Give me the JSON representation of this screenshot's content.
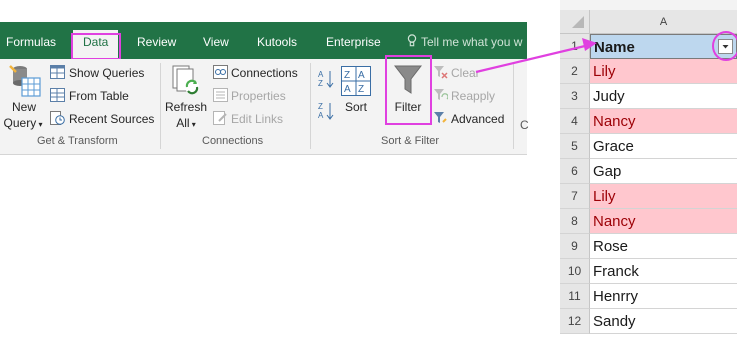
{
  "ribbon": {
    "tabs": [
      "Formulas",
      "Data",
      "Review",
      "View",
      "Kutools",
      "Enterprise"
    ],
    "tell_me": "Tell me what you w",
    "get_transform": {
      "new_query_line1": "New",
      "new_query_line2": "Query",
      "show_queries": "Show Queries",
      "from_table": "From Table",
      "recent_sources": "Recent Sources",
      "group_label": "Get & Transform"
    },
    "connections": {
      "refresh_line1": "Refresh",
      "refresh_line2": "All",
      "connections": "Connections",
      "properties": "Properties",
      "edit_links": "Edit Links",
      "group_label": "Connections"
    },
    "sort_filter": {
      "sort": "Sort",
      "filter": "Filter",
      "clear": "Clear",
      "reapply": "Reapply",
      "advanced": "Advanced",
      "group_label": "Sort & Filter"
    },
    "truncated_next": "C"
  },
  "sheet": {
    "column_header": "A",
    "header_row": {
      "row": "1",
      "value": "Name"
    },
    "rows": [
      {
        "row": "2",
        "value": "Lily",
        "duplicate": true
      },
      {
        "row": "3",
        "value": "Judy",
        "duplicate": false
      },
      {
        "row": "4",
        "value": "Nancy",
        "duplicate": true
      },
      {
        "row": "5",
        "value": "Grace",
        "duplicate": false
      },
      {
        "row": "6",
        "value": "Gap",
        "duplicate": false
      },
      {
        "row": "7",
        "value": "Lily",
        "duplicate": true
      },
      {
        "row": "8",
        "value": "Nancy",
        "duplicate": true
      },
      {
        "row": "9",
        "value": "Rose",
        "duplicate": false
      },
      {
        "row": "10",
        "value": "Franck",
        "duplicate": false
      },
      {
        "row": "11",
        "value": "Henrry",
        "duplicate": false
      },
      {
        "row": "12",
        "value": "Sandy",
        "duplicate": false
      }
    ]
  },
  "colors": {
    "ribbon_green": "#217346",
    "highlight_magenta": "#e040e0",
    "duplicate_fill": "#ffc7ce",
    "duplicate_text": "#9c0006",
    "header_fill": "#bdd7ee"
  }
}
